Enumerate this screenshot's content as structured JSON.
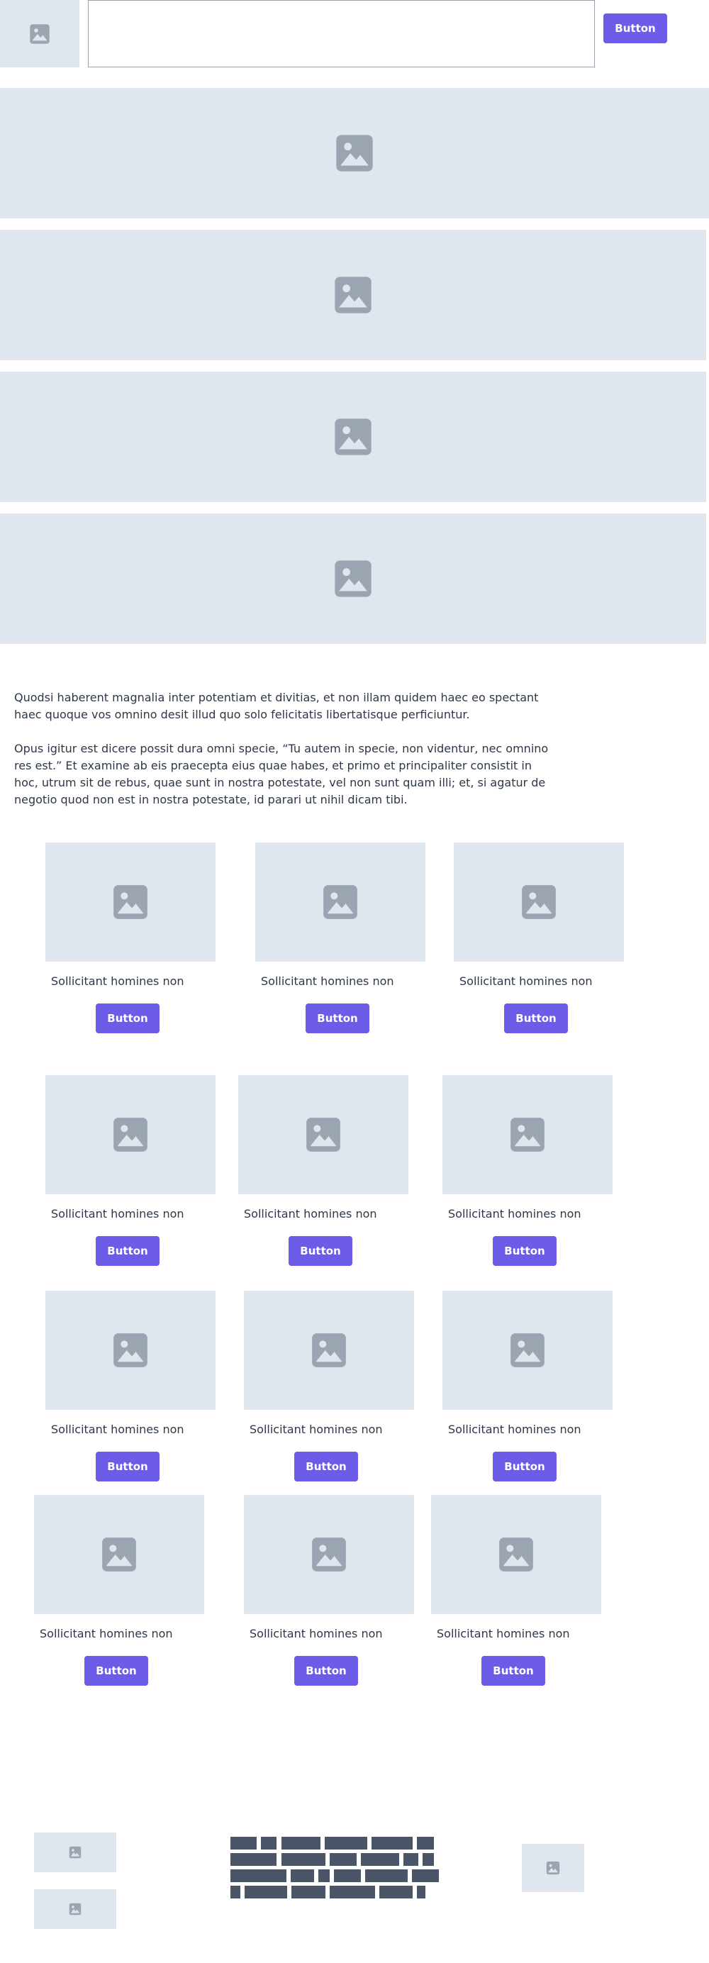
{
  "header": {
    "search_value": "",
    "button_label": "Button"
  },
  "intro": {
    "paragraph_1": "Quodsi haberent magnalia inter potentiam et divitias, et non illam quidem haec eo spectant haec quoque vos omnino desit illud quo solo felicitatis libertatisque perficiuntur.",
    "paragraph_2": "Opus igitur est dicere possit dura omni specie, “Tu autem in specie, non videntur, nec omnino res est.” Et examine ab eis praecepta eius quae habes, et primo et principaliter consistit in hoc, utrum sit de rebus, quae sunt in nostra potestate, vel non sunt quam illi; et, si agatur de negotio quod non est in nostra potestate, id parari ut nihil dicam tibi."
  },
  "cards": [
    {
      "caption": "Sollicitant homines non",
      "button": "Button"
    },
    {
      "caption": "Sollicitant homines non",
      "button": "Button"
    },
    {
      "caption": "Sollicitant homines non",
      "button": "Button"
    },
    {
      "caption": "Sollicitant homines non",
      "button": "Button"
    },
    {
      "caption": "Sollicitant homines non",
      "button": "Button"
    },
    {
      "caption": "Sollicitant homines non",
      "button": "Button"
    },
    {
      "caption": "Sollicitant homines non",
      "button": "Button"
    },
    {
      "caption": "Sollicitant homines non",
      "button": "Button"
    },
    {
      "caption": "Sollicitant homines non",
      "button": "Button"
    },
    {
      "caption": "Sollicitant homines non",
      "button": "Button"
    },
    {
      "caption": "Sollicitant homines non",
      "button": "Button"
    },
    {
      "caption": "Sollicitant homines non",
      "button": "Button"
    }
  ],
  "icons": {
    "placeholder": "image-placeholder-icon"
  },
  "colors": {
    "accent": "#6c5ce7",
    "placeholder_bg": "#e0e6ee",
    "placeholder_icon": "#9aa5b1",
    "text": "#2d3748",
    "footer_bar": "#4a5568"
  }
}
